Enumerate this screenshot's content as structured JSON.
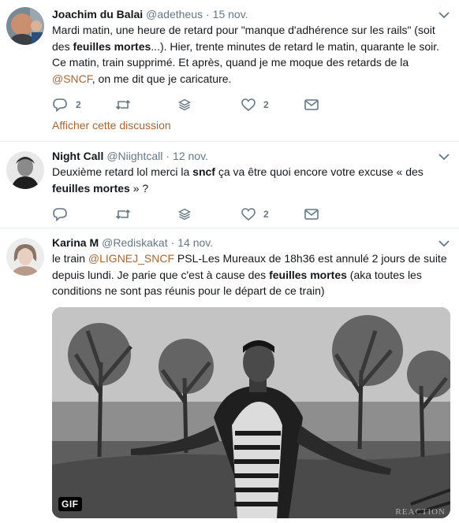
{
  "tweets": [
    {
      "fullname": "Joachim du Balai",
      "handle": "@adetheus",
      "time": "15 nov.",
      "text": {
        "p1": "Mardi matin, une heure de retard pour \"manque d'adhérence sur les rails\" (soit des ",
        "b1": "feuilles mortes",
        "p2": "...). Hier, trente minutes de retard le matin, quarante le soir. Ce matin, train supprimé. Et après, quand je me moque des retards de la ",
        "mention": "@SNCF",
        "p3": ", on me dit que je caricature."
      },
      "replies": "2",
      "likes": "2",
      "show_thread": "Afficher cette discussion"
    },
    {
      "fullname": "Night Call",
      "handle": "@Niightcall",
      "time": "12 nov.",
      "text": {
        "p1": "Deuxième retard lol merci la ",
        "b1": "sncf",
        "p2": " ça va être quoi encore votre excuse « des ",
        "b2": "feuilles mortes",
        "p3": " » ?"
      },
      "likes": "2"
    },
    {
      "fullname": "Karina M",
      "handle": "@Rediskakat",
      "time": "14 nov.",
      "text": {
        "p1": "le train ",
        "mention": "@LIGNEJ_SNCF",
        "p2": " PSL-Les Mureaux de 18h36 est annulé 2 jours de suite depuis lundi. Je parie que c'est à cause des ",
        "b1": "feuilles mortes",
        "p3": " (aka toutes les conditions ne sont pas réunis pour le départ de ce train)"
      },
      "media_badge": "GIF",
      "media_watermark": "REACTION"
    }
  ],
  "dot": "·",
  "colors": {
    "accent": "#a2663a",
    "secondary_text": "#657786",
    "divider": "#e6ecf0"
  },
  "icons": [
    "reply-icon",
    "retweet-icon",
    "stack-icon",
    "heart-icon",
    "message-icon",
    "chevron-down-icon"
  ]
}
